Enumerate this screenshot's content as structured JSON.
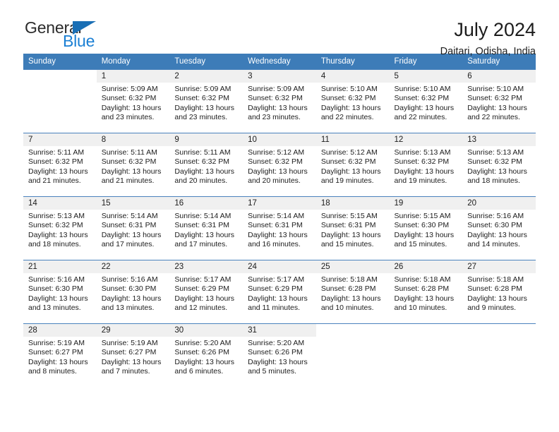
{
  "logo": {
    "word_one": "General",
    "word_two": "Blue",
    "triangle": "blue-triangle-icon",
    "color_dark": "#2b2b2b",
    "color_blue": "#1a7fd4"
  },
  "header": {
    "title": "July 2024",
    "subtitle": "Daitari, Odisha, India",
    "accent_color": "#3d7cb8"
  },
  "calendar": {
    "weekdays": [
      "Sunday",
      "Monday",
      "Tuesday",
      "Wednesday",
      "Thursday",
      "Friday",
      "Saturday"
    ],
    "weeks": [
      [
        {
          "day": "",
          "sunrise": "",
          "sunset": "",
          "daylight": "",
          "blank": true
        },
        {
          "day": "1",
          "sunrise": "Sunrise: 5:09 AM",
          "sunset": "Sunset: 6:32 PM",
          "daylight": "Daylight: 13 hours and 23 minutes."
        },
        {
          "day": "2",
          "sunrise": "Sunrise: 5:09 AM",
          "sunset": "Sunset: 6:32 PM",
          "daylight": "Daylight: 13 hours and 23 minutes."
        },
        {
          "day": "3",
          "sunrise": "Sunrise: 5:09 AM",
          "sunset": "Sunset: 6:32 PM",
          "daylight": "Daylight: 13 hours and 23 minutes."
        },
        {
          "day": "4",
          "sunrise": "Sunrise: 5:10 AM",
          "sunset": "Sunset: 6:32 PM",
          "daylight": "Daylight: 13 hours and 22 minutes."
        },
        {
          "day": "5",
          "sunrise": "Sunrise: 5:10 AM",
          "sunset": "Sunset: 6:32 PM",
          "daylight": "Daylight: 13 hours and 22 minutes."
        },
        {
          "day": "6",
          "sunrise": "Sunrise: 5:10 AM",
          "sunset": "Sunset: 6:32 PM",
          "daylight": "Daylight: 13 hours and 22 minutes."
        }
      ],
      [
        {
          "day": "7",
          "sunrise": "Sunrise: 5:11 AM",
          "sunset": "Sunset: 6:32 PM",
          "daylight": "Daylight: 13 hours and 21 minutes."
        },
        {
          "day": "8",
          "sunrise": "Sunrise: 5:11 AM",
          "sunset": "Sunset: 6:32 PM",
          "daylight": "Daylight: 13 hours and 21 minutes."
        },
        {
          "day": "9",
          "sunrise": "Sunrise: 5:11 AM",
          "sunset": "Sunset: 6:32 PM",
          "daylight": "Daylight: 13 hours and 20 minutes."
        },
        {
          "day": "10",
          "sunrise": "Sunrise: 5:12 AM",
          "sunset": "Sunset: 6:32 PM",
          "daylight": "Daylight: 13 hours and 20 minutes."
        },
        {
          "day": "11",
          "sunrise": "Sunrise: 5:12 AM",
          "sunset": "Sunset: 6:32 PM",
          "daylight": "Daylight: 13 hours and 19 minutes."
        },
        {
          "day": "12",
          "sunrise": "Sunrise: 5:13 AM",
          "sunset": "Sunset: 6:32 PM",
          "daylight": "Daylight: 13 hours and 19 minutes."
        },
        {
          "day": "13",
          "sunrise": "Sunrise: 5:13 AM",
          "sunset": "Sunset: 6:32 PM",
          "daylight": "Daylight: 13 hours and 18 minutes."
        }
      ],
      [
        {
          "day": "14",
          "sunrise": "Sunrise: 5:13 AM",
          "sunset": "Sunset: 6:32 PM",
          "daylight": "Daylight: 13 hours and 18 minutes."
        },
        {
          "day": "15",
          "sunrise": "Sunrise: 5:14 AM",
          "sunset": "Sunset: 6:31 PM",
          "daylight": "Daylight: 13 hours and 17 minutes."
        },
        {
          "day": "16",
          "sunrise": "Sunrise: 5:14 AM",
          "sunset": "Sunset: 6:31 PM",
          "daylight": "Daylight: 13 hours and 17 minutes."
        },
        {
          "day": "17",
          "sunrise": "Sunrise: 5:14 AM",
          "sunset": "Sunset: 6:31 PM",
          "daylight": "Daylight: 13 hours and 16 minutes."
        },
        {
          "day": "18",
          "sunrise": "Sunrise: 5:15 AM",
          "sunset": "Sunset: 6:31 PM",
          "daylight": "Daylight: 13 hours and 15 minutes."
        },
        {
          "day": "19",
          "sunrise": "Sunrise: 5:15 AM",
          "sunset": "Sunset: 6:30 PM",
          "daylight": "Daylight: 13 hours and 15 minutes."
        },
        {
          "day": "20",
          "sunrise": "Sunrise: 5:16 AM",
          "sunset": "Sunset: 6:30 PM",
          "daylight": "Daylight: 13 hours and 14 minutes."
        }
      ],
      [
        {
          "day": "21",
          "sunrise": "Sunrise: 5:16 AM",
          "sunset": "Sunset: 6:30 PM",
          "daylight": "Daylight: 13 hours and 13 minutes."
        },
        {
          "day": "22",
          "sunrise": "Sunrise: 5:16 AM",
          "sunset": "Sunset: 6:30 PM",
          "daylight": "Daylight: 13 hours and 13 minutes."
        },
        {
          "day": "23",
          "sunrise": "Sunrise: 5:17 AM",
          "sunset": "Sunset: 6:29 PM",
          "daylight": "Daylight: 13 hours and 12 minutes."
        },
        {
          "day": "24",
          "sunrise": "Sunrise: 5:17 AM",
          "sunset": "Sunset: 6:29 PM",
          "daylight": "Daylight: 13 hours and 11 minutes."
        },
        {
          "day": "25",
          "sunrise": "Sunrise: 5:18 AM",
          "sunset": "Sunset: 6:28 PM",
          "daylight": "Daylight: 13 hours and 10 minutes."
        },
        {
          "day": "26",
          "sunrise": "Sunrise: 5:18 AM",
          "sunset": "Sunset: 6:28 PM",
          "daylight": "Daylight: 13 hours and 10 minutes."
        },
        {
          "day": "27",
          "sunrise": "Sunrise: 5:18 AM",
          "sunset": "Sunset: 6:28 PM",
          "daylight": "Daylight: 13 hours and 9 minutes."
        }
      ],
      [
        {
          "day": "28",
          "sunrise": "Sunrise: 5:19 AM",
          "sunset": "Sunset: 6:27 PM",
          "daylight": "Daylight: 13 hours and 8 minutes."
        },
        {
          "day": "29",
          "sunrise": "Sunrise: 5:19 AM",
          "sunset": "Sunset: 6:27 PM",
          "daylight": "Daylight: 13 hours and 7 minutes."
        },
        {
          "day": "30",
          "sunrise": "Sunrise: 5:20 AM",
          "sunset": "Sunset: 6:26 PM",
          "daylight": "Daylight: 13 hours and 6 minutes."
        },
        {
          "day": "31",
          "sunrise": "Sunrise: 5:20 AM",
          "sunset": "Sunset: 6:26 PM",
          "daylight": "Daylight: 13 hours and 5 minutes."
        },
        {
          "day": "",
          "sunrise": "",
          "sunset": "",
          "daylight": "",
          "blank": true
        },
        {
          "day": "",
          "sunrise": "",
          "sunset": "",
          "daylight": "",
          "blank": true
        },
        {
          "day": "",
          "sunrise": "",
          "sunset": "",
          "daylight": "",
          "blank": true
        }
      ]
    ]
  }
}
